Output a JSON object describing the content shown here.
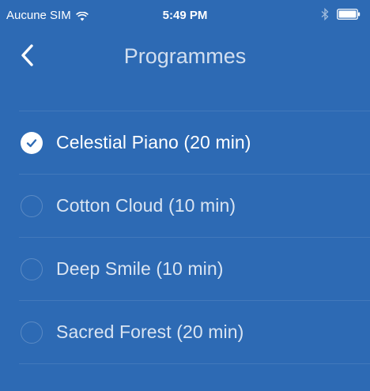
{
  "status_bar": {
    "carrier": "Aucune SIM",
    "time": "5:49 PM",
    "wifi_icon": "wifi-icon",
    "bluetooth_icon": "bluetooth-icon",
    "battery_icon": "battery-icon"
  },
  "nav": {
    "back_icon": "chevron-left-icon",
    "title": "Programmes"
  },
  "programmes": [
    {
      "label": "Celestial Piano (20 min)",
      "selected": true
    },
    {
      "label": "Cotton Cloud (10 min)",
      "selected": false
    },
    {
      "label": "Deep Smile (10 min)",
      "selected": false
    },
    {
      "label": "Sacred Forest (20 min)",
      "selected": false
    }
  ],
  "colors": {
    "background": "#2d6ab4",
    "text": "#ffffff"
  }
}
